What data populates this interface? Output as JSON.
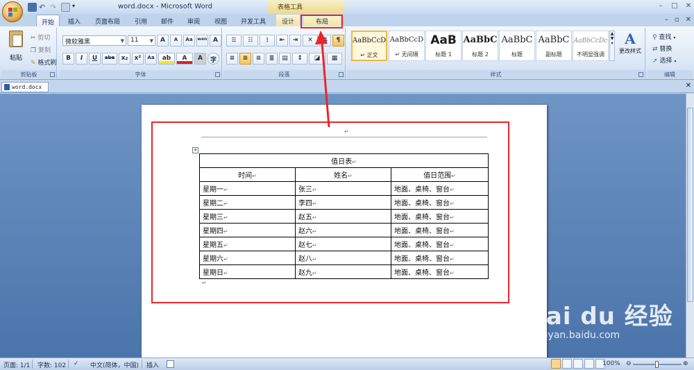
{
  "window": {
    "title": "word.docx - Microsoft Word",
    "context_group": "表格工具",
    "controls": [
      "–",
      "□",
      "✕"
    ]
  },
  "tabs": [
    {
      "label": "开始",
      "state": "active"
    },
    {
      "label": "插入"
    },
    {
      "label": "页面布局"
    },
    {
      "label": "引用"
    },
    {
      "label": "邮件"
    },
    {
      "label": "审阅"
    },
    {
      "label": "视图"
    },
    {
      "label": "开发工具"
    },
    {
      "label": "设计",
      "context": true
    },
    {
      "label": "布局",
      "context": true,
      "highlighted": true
    }
  ],
  "ribbon": {
    "clipboard": {
      "label": "剪贴板",
      "paste": "粘贴",
      "cut": "剪切",
      "copy": "复制",
      "format_painter": "格式刷"
    },
    "font": {
      "label": "字体",
      "font_name": "微软雅黑",
      "font_size": "11",
      "grow": "A",
      "shrink": "A",
      "clear": "Aa",
      "wen": "wén",
      "bold": "B",
      "italic": "I",
      "underline": "U",
      "strike": "abe",
      "sub": "x₂",
      "sup": "x²",
      "change_case": "Aa",
      "highlight": "ab",
      "font_color": "A",
      "char_shade": "A",
      "enclose": "字"
    },
    "paragraph": {
      "label": "段落"
    },
    "styles": {
      "label": "样式",
      "items": [
        {
          "sample": "AaBbCcD",
          "name": "↵ 正文",
          "selected": true
        },
        {
          "sample": "AaBbCcD",
          "name": "↵ 无间隔"
        },
        {
          "sample": "AaB",
          "name": "标题 1"
        },
        {
          "sample": "AaBbC",
          "name": "标题 2"
        },
        {
          "sample": "AaBbC",
          "name": "标题"
        },
        {
          "sample": "AaBbC",
          "name": "副标题"
        },
        {
          "sample": "AaBbCcDc",
          "name": "不明显强调"
        }
      ],
      "change_styles": "更改样式"
    },
    "editing": {
      "label": "编辑",
      "find": "查找",
      "replace": "替换",
      "select": "选择"
    }
  },
  "document": {
    "tab_name": "word.docx",
    "table": {
      "title": "值日表",
      "headers": [
        "时间",
        "姓名",
        "值日范围"
      ],
      "rows": [
        [
          "星期一",
          "张三",
          "地面、桌椅、窗台"
        ],
        [
          "星期二",
          "李四",
          "地面、桌椅、窗台"
        ],
        [
          "星期三",
          "赵五",
          "地面、桌椅、窗台"
        ],
        [
          "星期四",
          "赵六",
          "地面、桌椅、窗台"
        ],
        [
          "星期五",
          "赵七",
          "地面、桌椅、窗台"
        ],
        [
          "星期六",
          "赵八",
          "地面、桌椅、窗台"
        ],
        [
          "星期日",
          "赵九",
          "地面、桌椅、窗台"
        ]
      ],
      "paragraph_mark": "↵"
    }
  },
  "statusbar": {
    "page": "页面: 1/1",
    "words": "字数: 102",
    "language": "中文(简体，中国)",
    "mode": "插入",
    "zoom": "100%"
  },
  "watermark": {
    "brand": "Bai du 经验",
    "url": "jingyan.baidu.com"
  },
  "colors": {
    "annotation": "#e8262a",
    "ribbon": "#dbe7f6",
    "workspace": "#5b82b8"
  }
}
